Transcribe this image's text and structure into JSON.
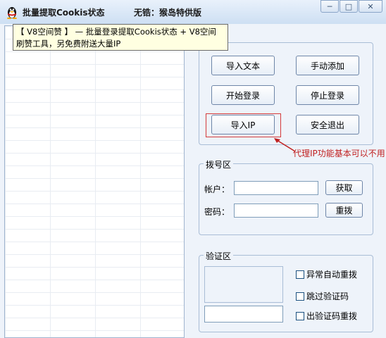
{
  "window": {
    "title": "批量提取Cookis状态",
    "subtitle": "无锆：猴岛特供版",
    "minimize": "─",
    "maximize": "□",
    "close": "✕"
  },
  "tooltip": {
    "line1": "【 V8空间赞 】 — 批量登录提取Cookis状态 + V8空间",
    "line2": "刷赞工具，另免费附送大量IP"
  },
  "actions": {
    "import_text": "导入文本",
    "manual_add": "手动添加",
    "start_login": "开始登录",
    "stop_login": "停止登录",
    "import_ip": "导入IP",
    "safe_exit": "安全退出"
  },
  "annotation": {
    "note": "代理IP功能基本可以不用"
  },
  "dial": {
    "title": "拨号区",
    "account_label": "帐户：",
    "password_label": "密码：",
    "fetch_button": "获取",
    "redial_button": "重拨"
  },
  "verify": {
    "title": "验证区",
    "options": [
      "异常自动重拨",
      "跳过验证码",
      "出验证码重拨"
    ]
  }
}
